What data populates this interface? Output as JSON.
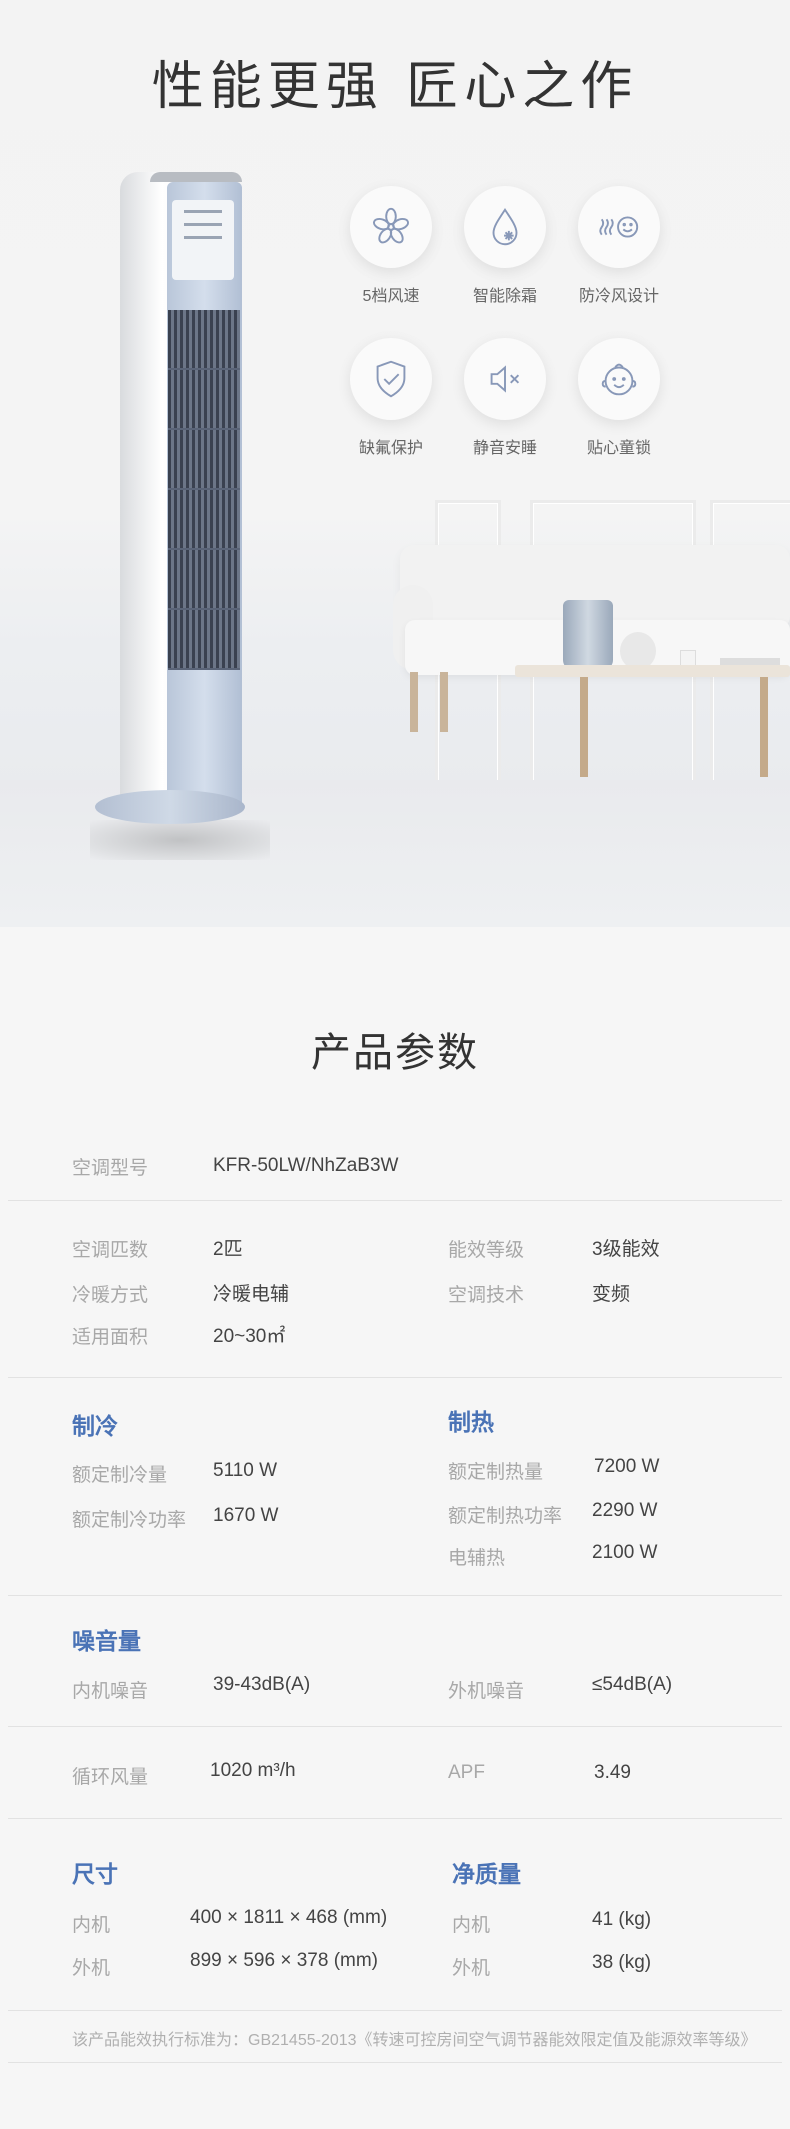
{
  "hero": {
    "title": "性能更强  匠心之作",
    "features": [
      {
        "icon": "fan-icon",
        "label": "5档风速"
      },
      {
        "icon": "drop-snowflake-icon",
        "label": "智能除霜"
      },
      {
        "icon": "wind-smile-icon",
        "label": "防冷风设计"
      },
      {
        "icon": "shield-check-icon",
        "label": "缺氟保护"
      },
      {
        "icon": "mute-speaker-icon",
        "label": "静音安睡"
      },
      {
        "icon": "baby-face-icon",
        "label": "贴心童锁"
      }
    ]
  },
  "specs": {
    "title": "产品参数",
    "model": {
      "label": "空调型号",
      "value": "KFR-50LW/NhZaB3W"
    },
    "general": {
      "hp_label": "空调匹数",
      "hp_value": "2匹",
      "energy_label": "能效等级",
      "energy_value": "3级能效",
      "mode_label": "冷暖方式",
      "mode_value": "冷暖电辅",
      "tech_label": "空调技术",
      "tech_value": "变频",
      "area_label": "适用面积",
      "area_value": "20~30㎡"
    },
    "cooling": {
      "title": "制冷",
      "capacity_label": "额定制冷量",
      "capacity_value": "5110 W",
      "power_label": "额定制冷功率",
      "power_value": "1670 W"
    },
    "heating": {
      "title": "制热",
      "capacity_label": "额定制热量",
      "capacity_value": "7200 W",
      "power_label": "额定制热功率",
      "power_value": "2290 W",
      "aux_label": "电辅热",
      "aux_value": "2100 W"
    },
    "noise": {
      "title": "噪音量",
      "indoor_label": "内机噪音",
      "indoor_value": "39-43dB(A)",
      "outdoor_label": "外机噪音",
      "outdoor_value": "≤54dB(A)"
    },
    "airflow": {
      "flow_label": "循环风量",
      "flow_value": "1020 m³/h",
      "apf_label": "APF",
      "apf_value": "3.49"
    },
    "size": {
      "title": "尺寸",
      "indoor_label": "内机",
      "indoor_value": "400 × 1811 × 468  (mm)",
      "outdoor_label": "外机",
      "outdoor_value": "899 × 596 × 378  (mm)"
    },
    "weight": {
      "title": "净质量",
      "indoor_label": "内机",
      "indoor_value": "41   (kg)",
      "outdoor_label": "外机",
      "outdoor_value": "38   (kg)"
    },
    "footnote": "该产品能效执行标准为：GB21455-2013《转速可控房间空气调节器能效限定值及能源效率等级》"
  },
  "colors": {
    "accent": "#4a73b6",
    "icon_stroke": "#8898b8",
    "label_gray": "#a8a8a8"
  }
}
